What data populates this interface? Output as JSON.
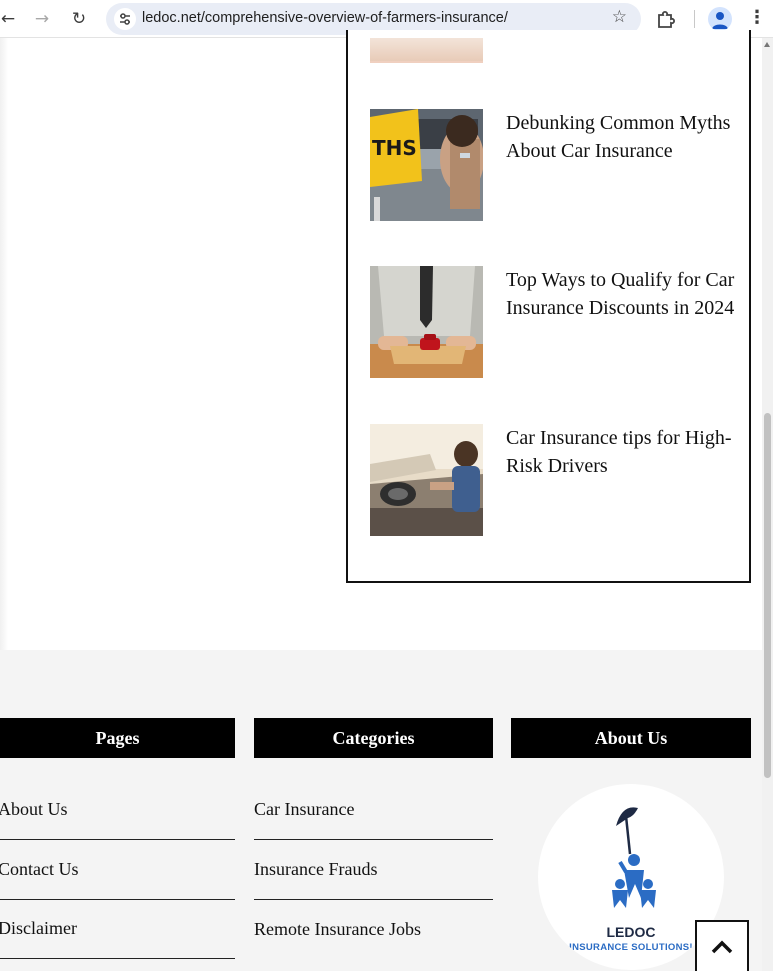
{
  "browser": {
    "url": "ledoc.net/comprehensive-overview-of-farmers-insurance/",
    "back_icon": "arrow-left-icon",
    "forward_icon": "arrow-right-icon",
    "reload_icon": "reload-icon",
    "bookmark_icon": "star-icon",
    "extensions_icon": "puzzle-icon",
    "profile_icon": "person-icon",
    "menu_icon": "kebab-menu-icon"
  },
  "recent_posts": [
    {
      "title": "Debunking Common Myths About Car Insurance",
      "image": "myths-road-sign-thumbnail"
    },
    {
      "title": "Top Ways to Qualify for Car Insurance Discounts in 2024",
      "image": "toy-car-envelope-thumbnail"
    },
    {
      "title": "Car Insurance tips for High-Risk Drivers",
      "image": "convertible-driver-thumbnail"
    }
  ],
  "footer": {
    "pages": {
      "heading": "Pages",
      "items": [
        "About Us",
        "Contact Us",
        "Disclaimer"
      ]
    },
    "categories": {
      "heading": "Categories",
      "items": [
        "Car Insurance",
        "Insurance Frauds",
        "Remote Insurance Jobs"
      ]
    },
    "about": {
      "heading": "About Us",
      "logo_name": "LEDOC",
      "logo_tagline": "INSURANCE SOLUTIONS!"
    }
  },
  "back_to_top_icon": "chevron-up-icon",
  "colors": {
    "accent": "#000000",
    "footer_bg": "#f4f4f4",
    "logo_blue": "#2b6cc4"
  }
}
